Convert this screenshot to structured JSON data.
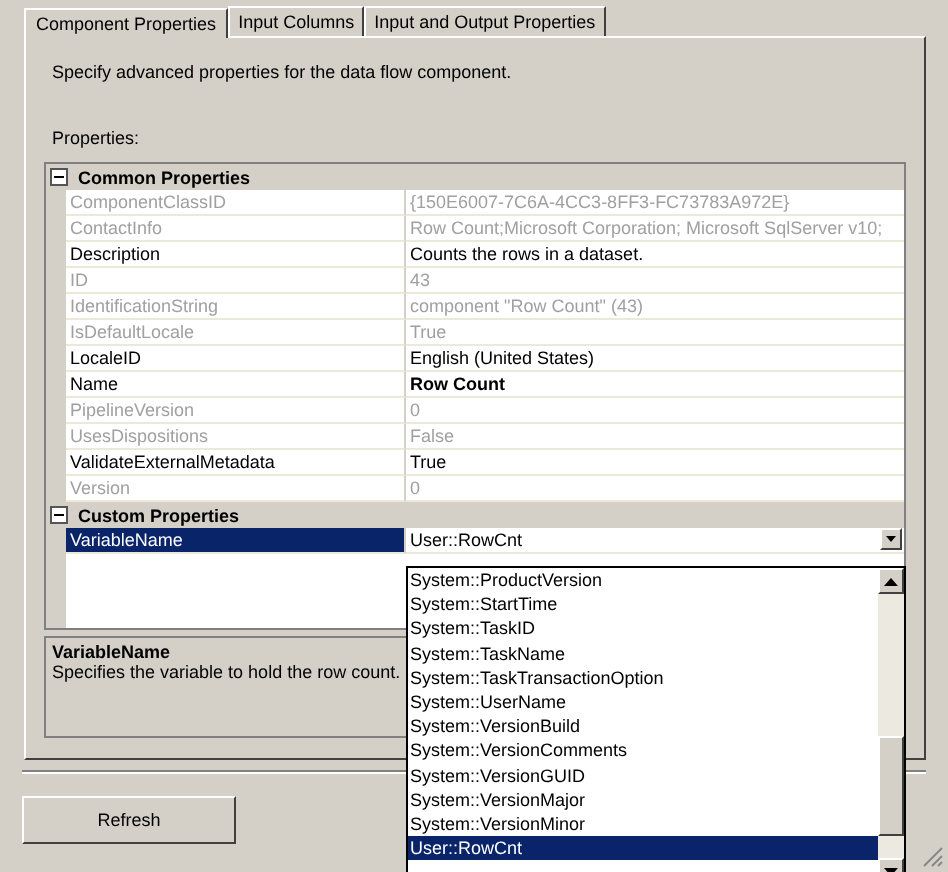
{
  "tabs": [
    {
      "label": "Component Properties",
      "selected": true
    },
    {
      "label": "Input Columns",
      "selected": false
    },
    {
      "label": "Input and Output Properties",
      "selected": false
    }
  ],
  "intro": "Specify advanced properties for the data flow component.",
  "properties_label": "Properties:",
  "grid": {
    "categories": [
      {
        "title": "Common Properties",
        "expanded": true,
        "rows": [
          {
            "name": "ComponentClassID",
            "value": "{150E6007-7C6A-4CC3-8FF3-FC73783A972E}",
            "disabled": true,
            "bold": false,
            "selected": false
          },
          {
            "name": "ContactInfo",
            "value": "Row Count;Microsoft Corporation; Microsoft SqlServer v10;",
            "disabled": true,
            "bold": false,
            "selected": false
          },
          {
            "name": "Description",
            "value": "Counts the rows in a dataset.",
            "disabled": false,
            "bold": false,
            "selected": false
          },
          {
            "name": "ID",
            "value": "43",
            "disabled": true,
            "bold": false,
            "selected": false
          },
          {
            "name": "IdentificationString",
            "value": "component \"Row Count\" (43)",
            "disabled": true,
            "bold": false,
            "selected": false
          },
          {
            "name": "IsDefaultLocale",
            "value": "True",
            "disabled": true,
            "bold": false,
            "selected": false
          },
          {
            "name": "LocaleID",
            "value": "English (United States)",
            "disabled": false,
            "bold": false,
            "selected": false
          },
          {
            "name": "Name",
            "value": "Row Count",
            "disabled": false,
            "bold": true,
            "selected": false
          },
          {
            "name": "PipelineVersion",
            "value": "0",
            "disabled": true,
            "bold": false,
            "selected": false
          },
          {
            "name": "UsesDispositions",
            "value": "False",
            "disabled": true,
            "bold": false,
            "selected": false
          },
          {
            "name": "ValidateExternalMetadata",
            "value": "True",
            "disabled": false,
            "bold": false,
            "selected": false
          },
          {
            "name": "Version",
            "value": "0",
            "disabled": true,
            "bold": false,
            "selected": false
          }
        ]
      },
      {
        "title": "Custom Properties",
        "expanded": true,
        "rows": [
          {
            "name": "VariableName",
            "value": "User::RowCnt",
            "disabled": false,
            "bold": false,
            "selected": true
          }
        ]
      }
    ]
  },
  "dropdown": {
    "items": [
      {
        "label": "System::ProductVersion",
        "selected": false
      },
      {
        "label": "System::StartTime",
        "selected": false
      },
      {
        "label": "System::TaskID",
        "selected": false
      },
      {
        "label": "System::TaskName",
        "selected": false
      },
      {
        "label": "System::TaskTransactionOption",
        "selected": false
      },
      {
        "label": "System::UserName",
        "selected": false
      },
      {
        "label": "System::VersionBuild",
        "selected": false
      },
      {
        "label": "System::VersionComments",
        "selected": false
      },
      {
        "label": "System::VersionGUID",
        "selected": false
      },
      {
        "label": "System::VersionMajor",
        "selected": false
      },
      {
        "label": "System::VersionMinor",
        "selected": false
      },
      {
        "label": "User::RowCnt",
        "selected": true
      }
    ]
  },
  "help": {
    "title": "VariableName",
    "text": "Specifies the variable to hold the row count."
  },
  "buttons": [
    "Refresh"
  ]
}
